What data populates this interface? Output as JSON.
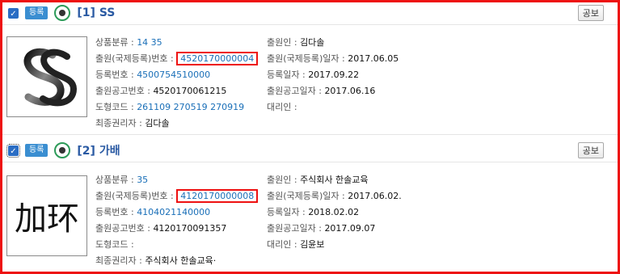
{
  "records": [
    {
      "checkbox": "✓",
      "status_badge": "등록",
      "title": "[1] SS",
      "gongbo_label": "공보",
      "thumbnail_desc": "SS logo",
      "left_fields": [
        {
          "label": "상품분류 :",
          "value": "14 35",
          "style": "link"
        },
        {
          "label": "출원(국제등록)번호 :",
          "value": "4520170000004",
          "style": "link",
          "highlight": true
        },
        {
          "label": "등록번호 :",
          "value": "4500754510000",
          "style": "link"
        },
        {
          "label": "출원공고번호 :",
          "value": "4520170061215",
          "style": "dark"
        },
        {
          "label": "도형코드 :",
          "value": "261109 270519 270919",
          "style": "link"
        },
        {
          "label": "최종권리자 :",
          "value": "김다솔",
          "style": "dark"
        }
      ],
      "right_fields": [
        {
          "label": "출원인 :",
          "value": "김다솔"
        },
        {
          "label": "출원(국제등록)일자 :",
          "value": "2017.06.05"
        },
        {
          "label": "등록일자 :",
          "value": "2017.09.22"
        },
        {
          "label": "출원공고일자 :",
          "value": "2017.06.16"
        },
        {
          "label": "대리인 :",
          "value": ""
        }
      ]
    },
    {
      "checkbox": "✓",
      "status_badge": "등록",
      "title": "[2] 가배",
      "gongbo_label": "공보",
      "thumbnail_text": "加环",
      "left_fields": [
        {
          "label": "상품분류 :",
          "value": "35",
          "style": "link"
        },
        {
          "label": "출원(국제등록)번호 :",
          "value": "4120170000008",
          "style": "link",
          "highlight": true
        },
        {
          "label": "등록번호 :",
          "value": "4104021140000",
          "style": "link"
        },
        {
          "label": "출원공고번호 :",
          "value": "4120170091357",
          "style": "dark"
        },
        {
          "label": "도형코드 :",
          "value": "",
          "style": "dark"
        },
        {
          "label": "최종권리자 :",
          "value": "주식회사 한솔교육·",
          "style": "dark"
        }
      ],
      "right_fields": [
        {
          "label": "출원인 :",
          "value": "주식회사 한솔교육"
        },
        {
          "label": "출원(국제등록)일자 :",
          "value": "2017.06.02."
        },
        {
          "label": "등록일자 :",
          "value": "2018.02.02"
        },
        {
          "label": "출원공고일자 :",
          "value": "2017.09.07"
        },
        {
          "label": "대리인 :",
          "value": "김윤보"
        }
      ]
    }
  ]
}
